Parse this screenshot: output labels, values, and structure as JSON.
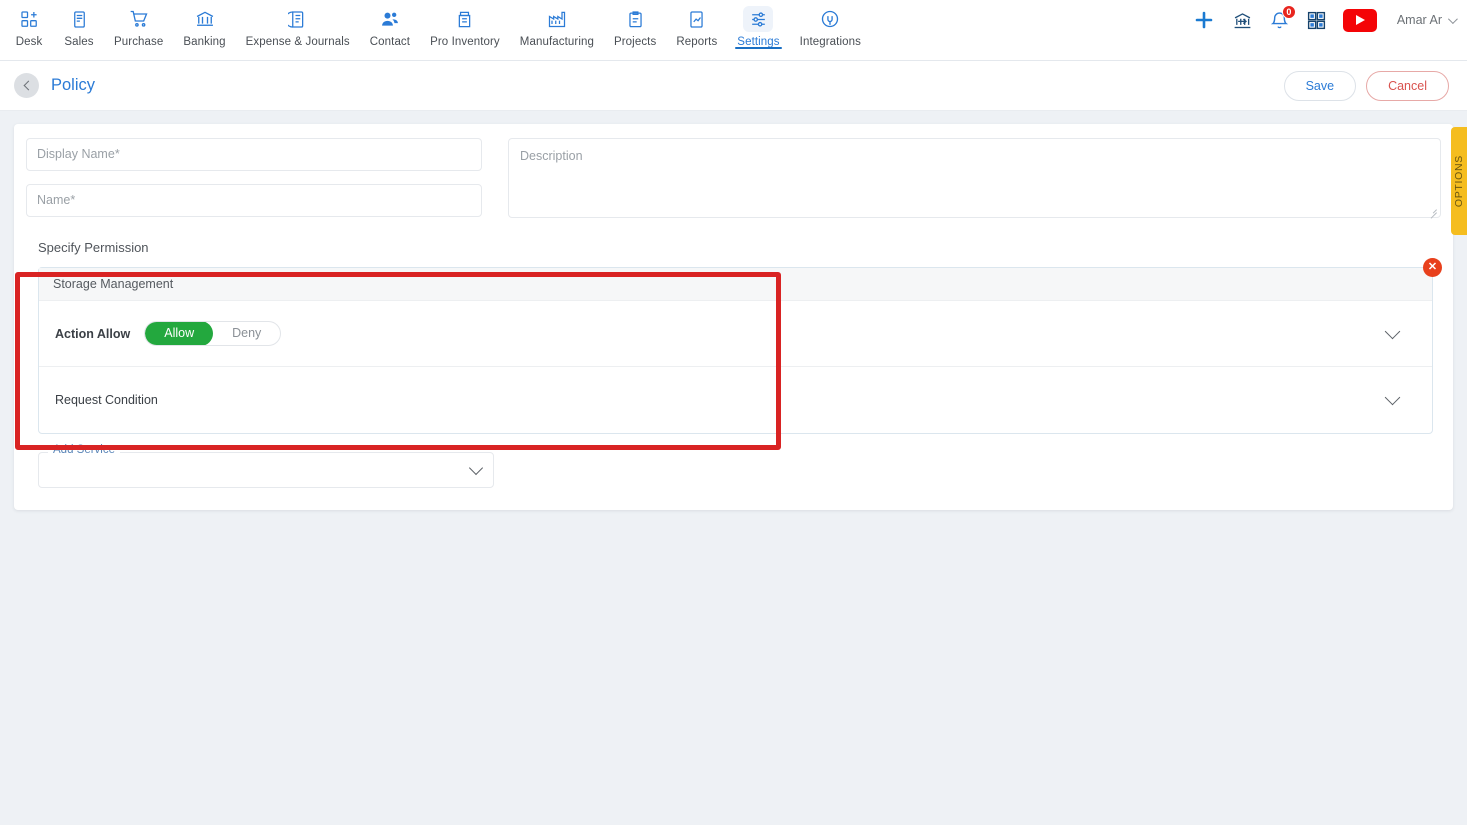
{
  "nav": {
    "items": [
      {
        "label": "Desk",
        "icon": "desk-grid-plus-icon",
        "active": false
      },
      {
        "label": "Sales",
        "icon": "sales-document-icon",
        "active": false
      },
      {
        "label": "Purchase",
        "icon": "purchase-cart-icon",
        "active": false
      },
      {
        "label": "Banking",
        "icon": "banking-bank-icon",
        "active": false
      },
      {
        "label": "Expense & Journals",
        "icon": "expense-journal-icon",
        "active": false
      },
      {
        "label": "Contact",
        "icon": "contact-people-icon",
        "active": false
      },
      {
        "label": "Pro Inventory",
        "icon": "inventory-box-icon",
        "active": false
      },
      {
        "label": "Manufacturing",
        "icon": "manufacturing-factory-icon",
        "active": false
      },
      {
        "label": "Projects",
        "icon": "projects-clipboard-icon",
        "active": false
      },
      {
        "label": "Reports",
        "icon": "reports-chart-icon",
        "active": false
      },
      {
        "label": "Settings",
        "icon": "settings-sliders-icon",
        "active": true
      },
      {
        "label": "Integrations",
        "icon": "integrations-plug-icon",
        "active": false
      }
    ],
    "right": {
      "add_icon": "plus-icon",
      "bank_icon": "bank-transfer-icon",
      "bell_icon": "bell-icon",
      "notification_count": "0",
      "apps_icon": "apps-grid-icon",
      "youtube_icon": "youtube-play-icon",
      "user_name": "Amar Ar",
      "user_caret_icon": "chevron-down-icon"
    }
  },
  "titlebar": {
    "back_icon": "chevron-left-icon",
    "title": "Policy",
    "save_label": "Save",
    "cancel_label": "Cancel"
  },
  "form": {
    "display_name_placeholder": "Display Name",
    "display_name_value": "",
    "name_placeholder": "Name",
    "name_value": "",
    "required_marker": "*",
    "description_placeholder": "Description",
    "description_value": ""
  },
  "permission": {
    "section_title": "Specify Permission",
    "service_name": "Storage Management",
    "close_icon": "close-icon",
    "rows": [
      {
        "label": "Action Allow",
        "options": [
          "Allow",
          "Deny"
        ],
        "selected": "Allow",
        "expand_icon": "chevron-down-icon"
      },
      {
        "label": "Request Condition",
        "expand_icon": "chevron-down-icon"
      }
    ]
  },
  "add_service": {
    "label": "Add Service",
    "value": "",
    "chevron_icon": "chevron-down-icon"
  },
  "options_tab": {
    "label": "OPTIONS"
  },
  "colors": {
    "accent_blue": "#2b7bd6",
    "allow_green": "#23a83e",
    "cancel_red": "#d9534f",
    "annotation_red": "#d92323",
    "close_red": "#e8401c",
    "options_yellow": "#f5bd1f",
    "page_bg": "#eef1f5"
  }
}
